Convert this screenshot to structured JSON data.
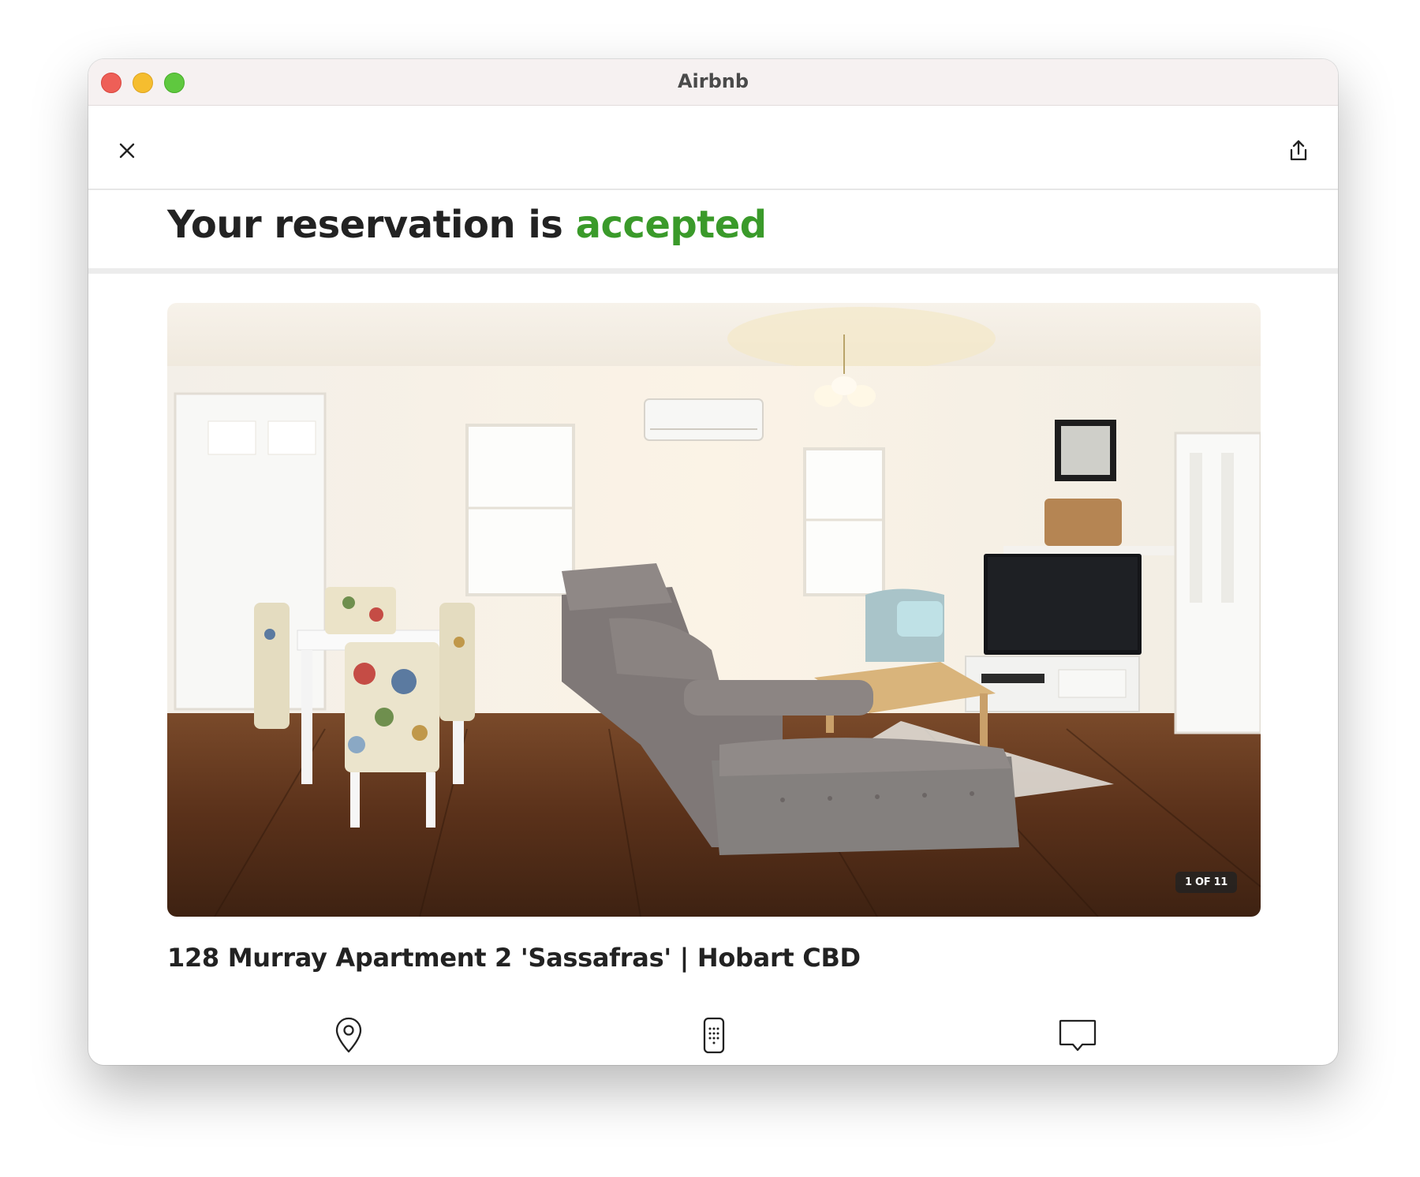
{
  "window": {
    "title": "Airbnb"
  },
  "toolbar": {
    "close_icon": "close-icon",
    "share_icon": "share-icon"
  },
  "heading": {
    "prefix": "Your reservation is ",
    "status": "accepted",
    "status_color": "#3a9a2a"
  },
  "photo": {
    "counter": "1 OF 11",
    "description": "living-room-photo"
  },
  "listing": {
    "title": "128 Murray Apartment 2 'Sassafras' | Hobart CBD"
  },
  "actions": [
    {
      "icon": "map-pin-icon"
    },
    {
      "icon": "keypad-icon"
    },
    {
      "icon": "message-icon"
    }
  ]
}
